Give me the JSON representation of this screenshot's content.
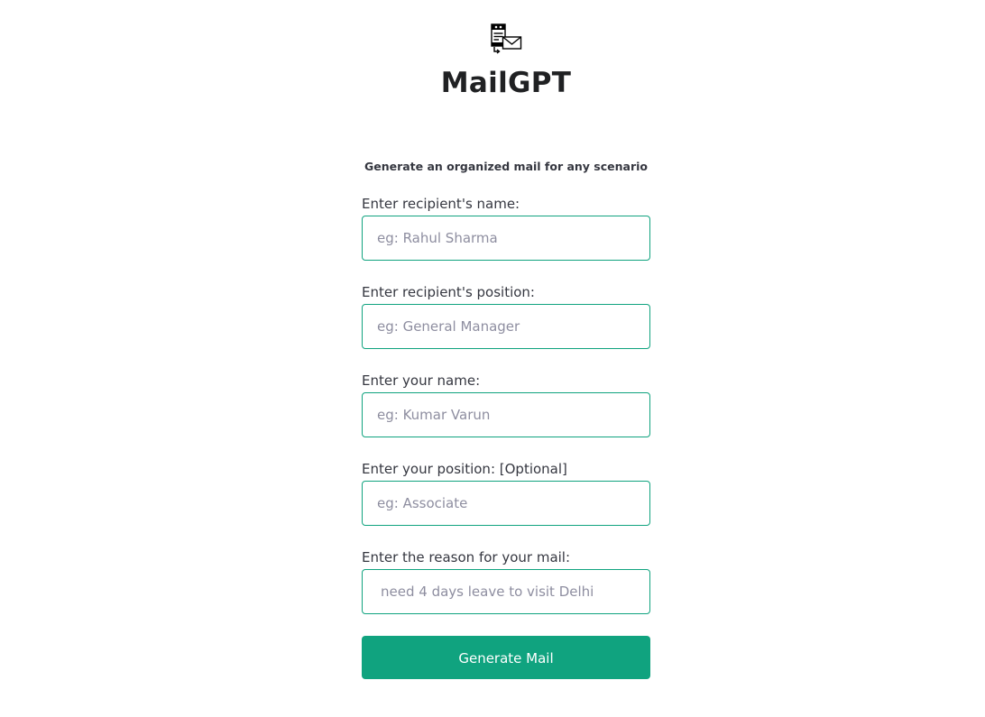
{
  "app": {
    "title": "MailGPT",
    "subtitle": "Generate an organized mail for any scenario",
    "logo_icon": "mail-document-icon"
  },
  "form": {
    "fields": [
      {
        "label": "Enter recipient's name:",
        "value": "",
        "placeholder": "eg: Rahul Sharma"
      },
      {
        "label": "Enter recipient's position:",
        "value": "",
        "placeholder": "eg: General Manager"
      },
      {
        "label": "Enter your name:",
        "value": "",
        "placeholder": "eg: Kumar Varun"
      },
      {
        "label": "Enter your position: [Optional]",
        "value": "",
        "placeholder": "eg: Associate"
      },
      {
        "label": "Enter the reason for your mail:",
        "value": "",
        "placeholder": "need 4 days leave to visit Delhi"
      }
    ],
    "submit_label": "Generate Mail"
  },
  "colors": {
    "accent": "#10a37f",
    "title_text": "#202123",
    "body_text": "#353740",
    "placeholder": "#8e8ea0",
    "background": "#ffffff"
  }
}
